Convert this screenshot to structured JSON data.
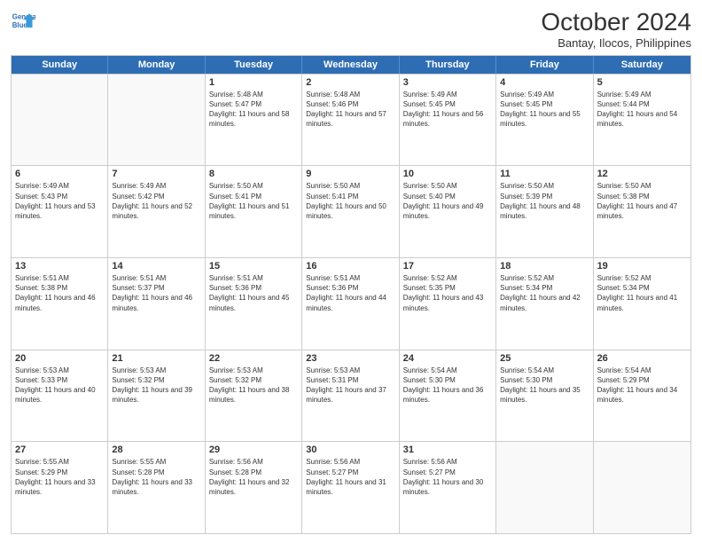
{
  "logo": {
    "line1": "General",
    "line2": "Blue"
  },
  "title": "October 2024",
  "subtitle": "Bantay, Ilocos, Philippines",
  "days": [
    "Sunday",
    "Monday",
    "Tuesday",
    "Wednesday",
    "Thursday",
    "Friday",
    "Saturday"
  ],
  "weeks": [
    [
      {
        "day": "",
        "info": ""
      },
      {
        "day": "",
        "info": ""
      },
      {
        "day": "1",
        "info": "Sunrise: 5:48 AM\nSunset: 5:47 PM\nDaylight: 11 hours and 58 minutes."
      },
      {
        "day": "2",
        "info": "Sunrise: 5:48 AM\nSunset: 5:46 PM\nDaylight: 11 hours and 57 minutes."
      },
      {
        "day": "3",
        "info": "Sunrise: 5:49 AM\nSunset: 5:45 PM\nDaylight: 11 hours and 56 minutes."
      },
      {
        "day": "4",
        "info": "Sunrise: 5:49 AM\nSunset: 5:45 PM\nDaylight: 11 hours and 55 minutes."
      },
      {
        "day": "5",
        "info": "Sunrise: 5:49 AM\nSunset: 5:44 PM\nDaylight: 11 hours and 54 minutes."
      }
    ],
    [
      {
        "day": "6",
        "info": "Sunrise: 5:49 AM\nSunset: 5:43 PM\nDaylight: 11 hours and 53 minutes."
      },
      {
        "day": "7",
        "info": "Sunrise: 5:49 AM\nSunset: 5:42 PM\nDaylight: 11 hours and 52 minutes."
      },
      {
        "day": "8",
        "info": "Sunrise: 5:50 AM\nSunset: 5:41 PM\nDaylight: 11 hours and 51 minutes."
      },
      {
        "day": "9",
        "info": "Sunrise: 5:50 AM\nSunset: 5:41 PM\nDaylight: 11 hours and 50 minutes."
      },
      {
        "day": "10",
        "info": "Sunrise: 5:50 AM\nSunset: 5:40 PM\nDaylight: 11 hours and 49 minutes."
      },
      {
        "day": "11",
        "info": "Sunrise: 5:50 AM\nSunset: 5:39 PM\nDaylight: 11 hours and 48 minutes."
      },
      {
        "day": "12",
        "info": "Sunrise: 5:50 AM\nSunset: 5:38 PM\nDaylight: 11 hours and 47 minutes."
      }
    ],
    [
      {
        "day": "13",
        "info": "Sunrise: 5:51 AM\nSunset: 5:38 PM\nDaylight: 11 hours and 46 minutes."
      },
      {
        "day": "14",
        "info": "Sunrise: 5:51 AM\nSunset: 5:37 PM\nDaylight: 11 hours and 46 minutes."
      },
      {
        "day": "15",
        "info": "Sunrise: 5:51 AM\nSunset: 5:36 PM\nDaylight: 11 hours and 45 minutes."
      },
      {
        "day": "16",
        "info": "Sunrise: 5:51 AM\nSunset: 5:36 PM\nDaylight: 11 hours and 44 minutes."
      },
      {
        "day": "17",
        "info": "Sunrise: 5:52 AM\nSunset: 5:35 PM\nDaylight: 11 hours and 43 minutes."
      },
      {
        "day": "18",
        "info": "Sunrise: 5:52 AM\nSunset: 5:34 PM\nDaylight: 11 hours and 42 minutes."
      },
      {
        "day": "19",
        "info": "Sunrise: 5:52 AM\nSunset: 5:34 PM\nDaylight: 11 hours and 41 minutes."
      }
    ],
    [
      {
        "day": "20",
        "info": "Sunrise: 5:53 AM\nSunset: 5:33 PM\nDaylight: 11 hours and 40 minutes."
      },
      {
        "day": "21",
        "info": "Sunrise: 5:53 AM\nSunset: 5:32 PM\nDaylight: 11 hours and 39 minutes."
      },
      {
        "day": "22",
        "info": "Sunrise: 5:53 AM\nSunset: 5:32 PM\nDaylight: 11 hours and 38 minutes."
      },
      {
        "day": "23",
        "info": "Sunrise: 5:53 AM\nSunset: 5:31 PM\nDaylight: 11 hours and 37 minutes."
      },
      {
        "day": "24",
        "info": "Sunrise: 5:54 AM\nSunset: 5:30 PM\nDaylight: 11 hours and 36 minutes."
      },
      {
        "day": "25",
        "info": "Sunrise: 5:54 AM\nSunset: 5:30 PM\nDaylight: 11 hours and 35 minutes."
      },
      {
        "day": "26",
        "info": "Sunrise: 5:54 AM\nSunset: 5:29 PM\nDaylight: 11 hours and 34 minutes."
      }
    ],
    [
      {
        "day": "27",
        "info": "Sunrise: 5:55 AM\nSunset: 5:29 PM\nDaylight: 11 hours and 33 minutes."
      },
      {
        "day": "28",
        "info": "Sunrise: 5:55 AM\nSunset: 5:28 PM\nDaylight: 11 hours and 33 minutes."
      },
      {
        "day": "29",
        "info": "Sunrise: 5:56 AM\nSunset: 5:28 PM\nDaylight: 11 hours and 32 minutes."
      },
      {
        "day": "30",
        "info": "Sunrise: 5:56 AM\nSunset: 5:27 PM\nDaylight: 11 hours and 31 minutes."
      },
      {
        "day": "31",
        "info": "Sunrise: 5:56 AM\nSunset: 5:27 PM\nDaylight: 11 hours and 30 minutes."
      },
      {
        "day": "",
        "info": ""
      },
      {
        "day": "",
        "info": ""
      }
    ]
  ]
}
